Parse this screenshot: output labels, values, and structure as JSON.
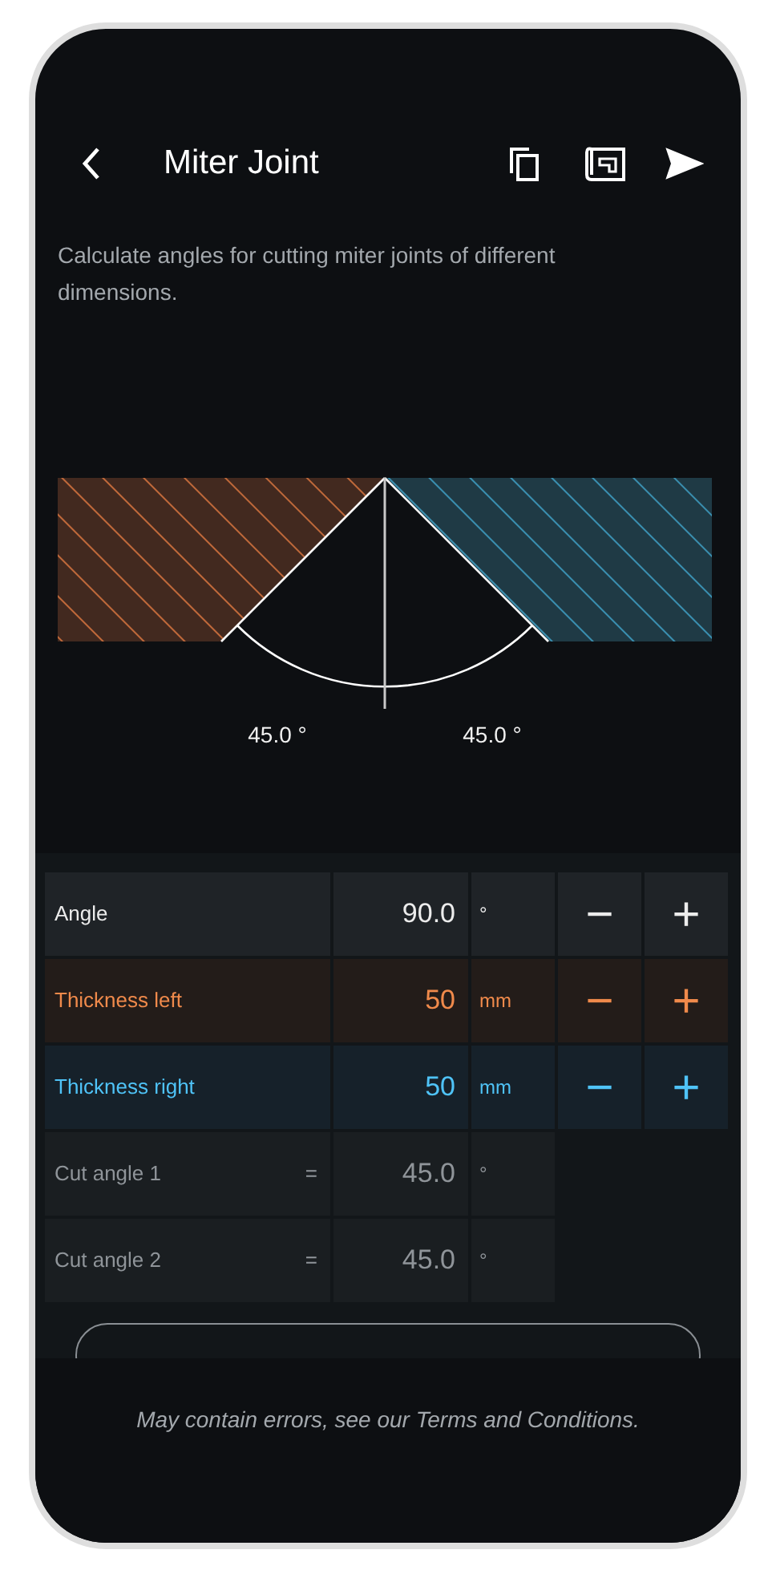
{
  "header": {
    "title": "Miter Joint"
  },
  "description": "Calculate angles for cutting miter joints of different dimensions.",
  "diagram": {
    "left_angle": "45.0 °",
    "right_angle": "45.0 °"
  },
  "rows": [
    {
      "kind": "input",
      "label": "Angle",
      "value": "90.0",
      "unit": "°",
      "color": "#ececec",
      "minus": "−",
      "plus": "+"
    },
    {
      "kind": "input",
      "label": "Thickness left",
      "value": "50",
      "unit": "mm",
      "color": "#f08a4b",
      "minus": "−",
      "plus": "+"
    },
    {
      "kind": "input",
      "label": "Thickness right",
      "value": "50",
      "unit": "mm",
      "color": "#4fc3f7",
      "minus": "−",
      "plus": "+"
    },
    {
      "kind": "result",
      "label": "Cut angle 1",
      "sign": "=",
      "value": "45.0",
      "unit": "°"
    },
    {
      "kind": "result",
      "label": "Cut angle 2",
      "sign": "=",
      "value": "45.0",
      "unit": "°"
    }
  ],
  "footer": "May contain errors, see our Terms and Conditions."
}
